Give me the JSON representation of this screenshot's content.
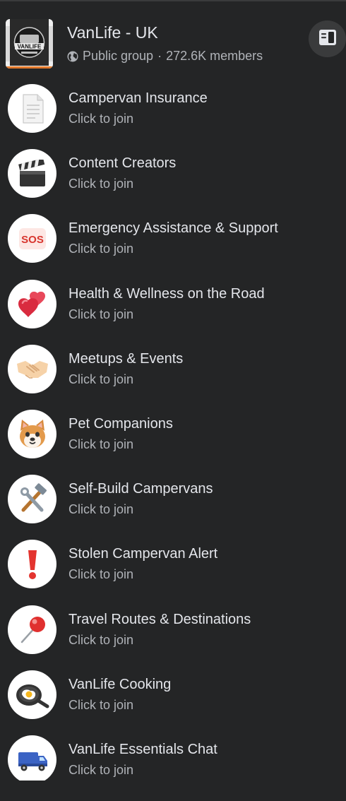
{
  "group": {
    "name": "VanLife - UK",
    "privacy": "Public group",
    "separator": "·",
    "members": "272.6K members",
    "logo_text": "VANLIFE"
  },
  "chats": [
    {
      "title": "Campervan Insurance",
      "status": "Click to join",
      "icon": "document-icon"
    },
    {
      "title": "Content Creators",
      "status": "Click to join",
      "icon": "clapperboard-icon"
    },
    {
      "title": "Emergency Assistance & Support",
      "status": "Click to join",
      "icon": "sos-icon",
      "icon_text": "SOS"
    },
    {
      "title": "Health & Wellness on the Road",
      "status": "Click to join",
      "icon": "hearts-icon"
    },
    {
      "title": "Meetups & Events",
      "status": "Click to join",
      "icon": "handshake-icon"
    },
    {
      "title": "Pet Companions",
      "status": "Click to join",
      "icon": "dog-face-icon"
    },
    {
      "title": "Self-Build Campervans",
      "status": "Click to join",
      "icon": "hammer-wrench-icon"
    },
    {
      "title": "Stolen Campervan Alert",
      "status": "Click to join",
      "icon": "exclamation-icon"
    },
    {
      "title": "Travel Routes & Destinations",
      "status": "Click to join",
      "icon": "pushpin-icon"
    },
    {
      "title": "VanLife Cooking",
      "status": "Click to join",
      "icon": "frying-pan-icon"
    },
    {
      "title": "VanLife Essentials Chat",
      "status": "Click to join",
      "icon": "truck-icon"
    }
  ],
  "colors": {
    "background": "#242526",
    "primary_text": "#e4e6eb",
    "secondary_text": "#b0b3b8",
    "accent_orange": "#e4792b"
  }
}
